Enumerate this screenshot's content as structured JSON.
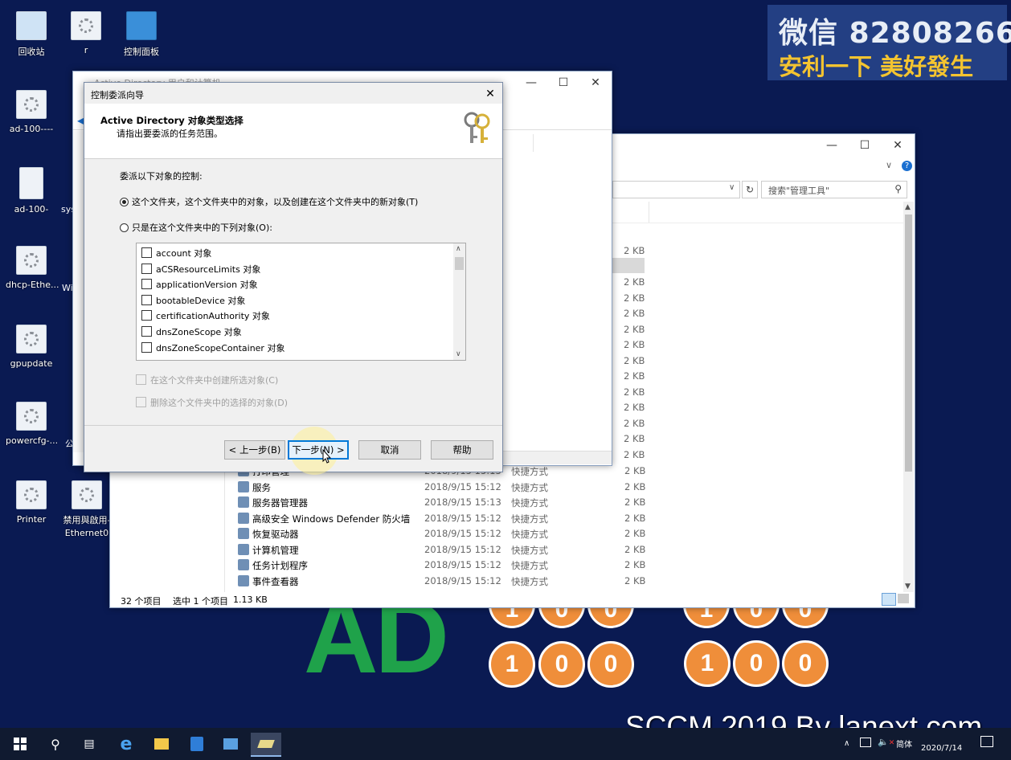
{
  "desktop": {
    "icons": [
      {
        "label": "回收站"
      },
      {
        "label": "r"
      },
      {
        "label": "控制面板"
      },
      {
        "label": "ad-100----"
      },
      {
        "label": "ad-100-"
      },
      {
        "label": "sys"
      },
      {
        "label": "dhcp-Ethe..."
      },
      {
        "label": "Wi"
      },
      {
        "label": "gpupdate"
      },
      {
        "label": "powercfg-..."
      },
      {
        "label": "公"
      },
      {
        "label": "Printer"
      },
      {
        "label": "禁用與啟用-Ethernet0"
      }
    ]
  },
  "watermark": {
    "line1": "微信 82808266",
    "line2": "安利一下 美好發生"
  },
  "logo": {
    "text": "AD",
    "digits_top": [
      "1",
      "0",
      "0",
      "1",
      "0",
      "0"
    ],
    "digits_bottom": [
      "1",
      "0",
      "0",
      "1",
      "0",
      "0"
    ]
  },
  "branding": {
    "text": "SCCM 2019 By lanext.com"
  },
  "ad_window": {
    "title": "Active Directory 用户和计算机"
  },
  "explorer": {
    "search_placeholder": "搜索\"管理工具\"",
    "sizes_top": [
      "2 KB",
      "2 KB",
      "2 KB",
      "2 KB",
      "2 KB",
      "2 KB",
      "2 KB",
      "2 KB",
      "2 KB",
      "2 KB",
      "2 KB",
      "2 KB",
      "2 KB",
      "2 KB"
    ],
    "rows": [
      {
        "name": "打印管理",
        "date": "2018/9/15 15:13",
        "type": "快捷方式",
        "size": "2 KB"
      },
      {
        "name": "服务",
        "date": "2018/9/15 15:12",
        "type": "快捷方式",
        "size": "2 KB"
      },
      {
        "name": "服务器管理器",
        "date": "2018/9/15 15:13",
        "type": "快捷方式",
        "size": "2 KB"
      },
      {
        "name": "高级安全 Windows Defender 防火墙",
        "date": "2018/9/15 15:12",
        "type": "快捷方式",
        "size": "2 KB"
      },
      {
        "name": "恢复驱动器",
        "date": "2018/9/15 15:12",
        "type": "快捷方式",
        "size": "2 KB"
      },
      {
        "name": "计算机管理",
        "date": "2018/9/15 15:12",
        "type": "快捷方式",
        "size": "2 KB"
      },
      {
        "name": "任务计划程序",
        "date": "2018/9/15 15:12",
        "type": "快捷方式",
        "size": "2 KB"
      },
      {
        "name": "事件查看器",
        "date": "2018/9/15 15:12",
        "type": "快捷方式",
        "size": "2 KB"
      }
    ],
    "status": {
      "count": "32 个项目",
      "selected": "选中 1 个项目",
      "size": "1.13 KB"
    }
  },
  "dialog": {
    "title": "控制委派向导",
    "header_title": "Active Directory 对象类型选择",
    "header_subtitle": "请指出要委派的任务范围。",
    "delegate_label": "委派以下对象的控制:",
    "radio_all": "这个文件夹，这个文件夹中的对象，以及创建在这个文件夹中的新对象(T)",
    "radio_only": "只是在这个文件夹中的下列对象(O):",
    "objects": [
      "account 对象",
      "aCSResourceLimits 对象",
      "applicationVersion 对象",
      "bootableDevice 对象",
      "certificationAuthority 对象",
      "dnsZoneScope 对象",
      "dnsZoneScopeContainer 对象"
    ],
    "create_label": "在这个文件夹中创建所选对象(C)",
    "delete_label": "删除这个文件夹中的选择的对象(D)",
    "back": "< 上一步(B)",
    "next": "下一步(N) >",
    "cancel": "取消",
    "help": "帮助"
  },
  "taskbar": {
    "lang": "简体",
    "date": "2020/7/14"
  }
}
